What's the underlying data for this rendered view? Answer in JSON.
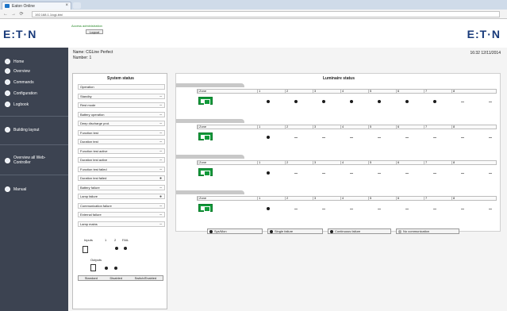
{
  "browser": {
    "tab_title": "Eaton Online",
    "url": "192.168.1.1/cgi-bin/",
    "back": "←",
    "forward": "→",
    "reload": "⟳"
  },
  "header": {
    "logo_left": "E:T·N",
    "logo_right": "E:T·N",
    "device_label": "Access administration",
    "login_label": "Logout"
  },
  "sidebar": {
    "items": [
      {
        "label": "Home",
        "icon": "home-icon"
      },
      {
        "label": "Overview",
        "icon": "overview-icon"
      },
      {
        "label": "Commands",
        "icon": "commands-icon"
      },
      {
        "label": "Configuration",
        "icon": "configuration-icon"
      },
      {
        "label": "Logbook",
        "icon": "logbook-icon"
      },
      {
        "label": "Building layout",
        "icon": "building-icon"
      },
      {
        "label": "Overview all Web-Controller",
        "icon": "controller-icon"
      },
      {
        "label": "Manual",
        "icon": "manual-icon"
      }
    ]
  },
  "info": {
    "name": "Name: CGLine Perfect",
    "number": "Number: 1",
    "datetime": "16:32 12/11/2014"
  },
  "system_status": {
    "title": "System status",
    "rows": [
      {
        "label": "Operation",
        "value": ""
      },
      {
        "label": "Standby",
        "value": "–"
      },
      {
        "label": "Rest mode",
        "value": "–"
      },
      {
        "label": "Battery operation",
        "value": "–"
      },
      {
        "label": "Deep discharge prot.",
        "value": "–"
      },
      {
        "label": "Function test",
        "value": "–"
      },
      {
        "label": "Duration test",
        "value": "–"
      },
      {
        "label": "Function test active",
        "value": "–"
      },
      {
        "label": "Duration test active",
        "value": "–"
      },
      {
        "label": "Function test failed",
        "value": "–"
      },
      {
        "label": "Duration test failed",
        "value": "●"
      },
      {
        "label": "Battery failure",
        "value": "–"
      },
      {
        "label": "Lamp failure",
        "value": "●"
      },
      {
        "label": "Communication failure",
        "value": "–"
      },
      {
        "label": "External failure",
        "value": "–"
      },
      {
        "label": "Lamp mains",
        "value": "–"
      }
    ],
    "inputs_label": "Inputs",
    "outputs_label": "Outputs",
    "heads": [
      "1",
      "2",
      "FAIL"
    ],
    "legend": [
      "Standard",
      "Disabled",
      "Switch/Enabled"
    ]
  },
  "luminaire_status": {
    "title": "Luminaire status",
    "rows": [
      {
        "label": "Circuit 1",
        "state": [
          "●",
          "●",
          "●",
          "●",
          "●",
          "●",
          "●",
          "–",
          "–"
        ]
      },
      {
        "label": "Circuit 2",
        "state": [
          "●",
          "–",
          "–",
          "–",
          "–",
          "–",
          "–",
          "–",
          "–"
        ]
      },
      {
        "label": "Circuit 3",
        "state": [
          "●",
          "–",
          "–",
          "–",
          "–",
          "–",
          "–",
          "–",
          "–"
        ]
      },
      {
        "label": "Circuit 4",
        "state": [
          "●",
          "–",
          "–",
          "–",
          "–",
          "–",
          "–",
          "–",
          "–"
        ]
      }
    ],
    "columns": [
      "Zone",
      "1",
      "2",
      "3",
      "4",
      "5",
      "6",
      "7",
      "8"
    ],
    "legend": [
      "Sys/Mon",
      "Single failure",
      "Continuous failure",
      "No communication"
    ]
  }
}
